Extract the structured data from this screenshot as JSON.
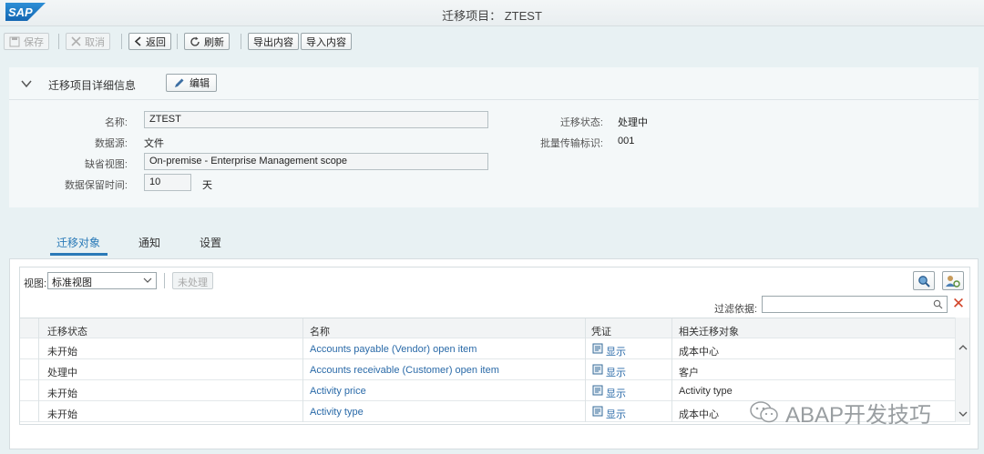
{
  "app": {
    "title": "迁移项目：  ZTEST",
    "logo_text": "SAP"
  },
  "toolbar": {
    "save": "保存",
    "cancel": "取消",
    "back": "返回",
    "refresh": "刷新",
    "export": "导出内容",
    "import": "导入内容"
  },
  "details": {
    "title": "迁移项目详细信息",
    "edit": "编辑",
    "fields": {
      "name_label": "名称:",
      "name_value": "ZTEST",
      "source_label": "数据源:",
      "source_value": "文件",
      "default_view_label": "缺省视图:",
      "default_view_value": "On-premise - Enterprise Management scope",
      "retention_label": "数据保留时间:",
      "retention_value": "10",
      "retention_unit": "天",
      "status_label": "迁移状态:",
      "status_value": "处理中",
      "mass_transfer_label": "批量传输标识:",
      "mass_transfer_value": "001"
    }
  },
  "tabs": [
    {
      "label": "迁移对象",
      "active": true
    },
    {
      "label": "通知",
      "active": false
    },
    {
      "label": "设置",
      "active": false
    }
  ],
  "objects": {
    "view_label": "视图:",
    "view_selected": "标准视图",
    "unprocessed": "未处理",
    "filter_label": "过滤依据:",
    "filter_value": "",
    "columns": [
      "迁移状态",
      "名称",
      "凭证",
      "相关迁移对象"
    ],
    "rows": [
      {
        "status": "未开始",
        "name": "Accounts payable (Vendor) open item",
        "doc": "显示",
        "related": "成本中心"
      },
      {
        "status": "处理中",
        "name": "Accounts receivable (Customer) open item",
        "doc": "显示",
        "related": "客户"
      },
      {
        "status": "未开始",
        "name": "Activity price",
        "doc": "显示",
        "related": "Activity type"
      },
      {
        "status": "未开始",
        "name": "Activity type",
        "doc": "显示",
        "related": "成本中心"
      }
    ]
  },
  "watermark": "ABAP开发技巧",
  "colors": {
    "accent": "#2a7ab8",
    "link": "#2a6aa8",
    "clear_x": "#d2452a",
    "background": "#e8f1f3"
  }
}
